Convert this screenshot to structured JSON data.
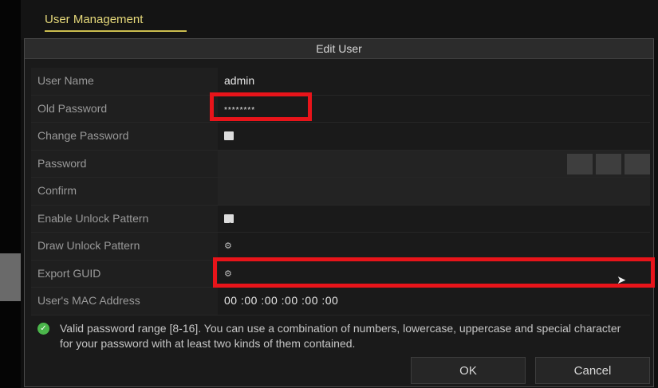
{
  "header": {
    "tab_title": "User Management"
  },
  "dialog": {
    "title": "Edit User",
    "fields": [
      {
        "label": "User Name",
        "value": "admin"
      },
      {
        "label": "Old Password",
        "value": "********"
      },
      {
        "label": "Change Password",
        "checked": false
      },
      {
        "label": "Password",
        "value": ""
      },
      {
        "label": "Confirm",
        "value": ""
      },
      {
        "label": "Enable Unlock Pattern",
        "checked": true
      },
      {
        "label": "Draw Unlock Pattern",
        "icon": "gear-icon"
      },
      {
        "label": "Export GUID",
        "icon": "gear-icon"
      },
      {
        "label": "User's MAC Address",
        "value": "00 :00 :00 :00 :00 :00"
      }
    ],
    "hint": "Valid password range [8-16]. You can use a combination of numbers, lowercase, uppercase and special character for your password with at least two kinds of them contained.",
    "ok_label": "OK",
    "cancel_label": "Cancel"
  },
  "colors": {
    "highlight": "#e8141a",
    "hint_icon": "#4bb64b",
    "tab_accent": "#cbbd4f"
  }
}
